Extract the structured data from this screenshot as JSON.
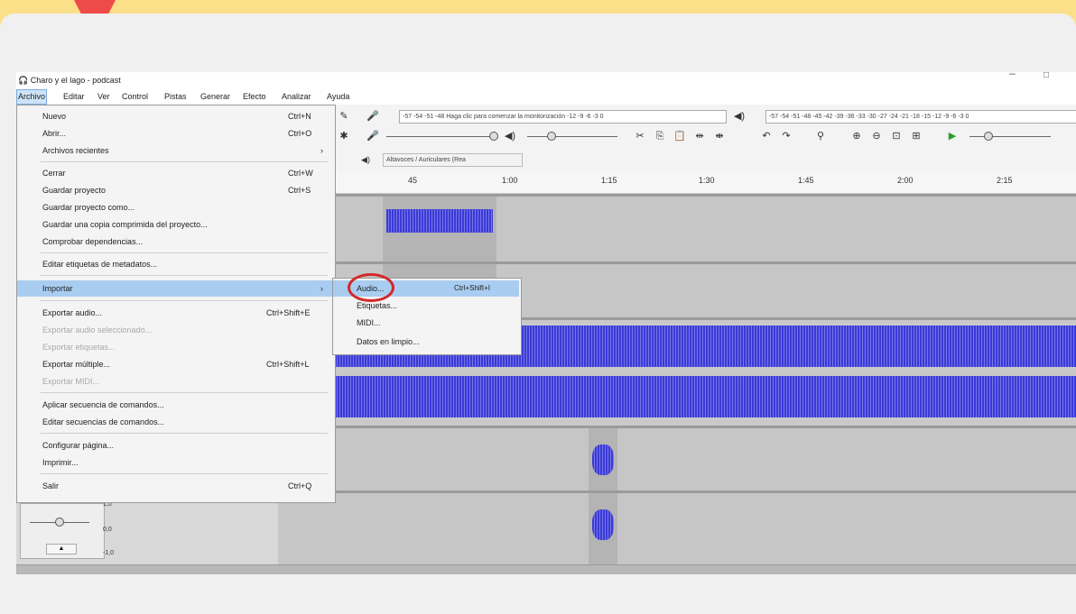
{
  "window": {
    "title": "Charo y el lago - podcast",
    "minimize": "–",
    "maximize": "□"
  },
  "menubar": [
    "Archivo",
    "Editar",
    "Ver",
    "Control",
    "Pistas",
    "Generar",
    "Efecto",
    "Analizar",
    "Ayuda"
  ],
  "file_menu": [
    {
      "label": "Nuevo",
      "shortcut": "Ctrl+N",
      "state": "normal"
    },
    {
      "label": "Abrir...",
      "shortcut": "Ctrl+O",
      "state": "normal"
    },
    {
      "label": "Archivos recientes",
      "shortcut": "",
      "arrow": "›",
      "state": "normal"
    },
    {
      "label": "Cerrar",
      "shortcut": "Ctrl+W",
      "state": "normal"
    },
    {
      "label": "Guardar proyecto",
      "shortcut": "Ctrl+S",
      "state": "normal"
    },
    {
      "label": "Guardar proyecto como...",
      "shortcut": "",
      "state": "normal"
    },
    {
      "label": "Guardar una copia comprimida del proyecto...",
      "shortcut": "",
      "state": "normal"
    },
    {
      "label": "Comprobar dependencias...",
      "shortcut": "",
      "state": "normal"
    },
    {
      "label": "Editar etiquetas de metadatos...",
      "shortcut": "",
      "state": "normal"
    },
    {
      "label": "Importar",
      "shortcut": "",
      "arrow": "›",
      "state": "highlighted"
    },
    {
      "label": "Exportar audio...",
      "shortcut": "Ctrl+Shift+E",
      "state": "normal"
    },
    {
      "label": "Exportar audio seleccionado...",
      "shortcut": "",
      "state": "disabled"
    },
    {
      "label": "Exportar etiquetas...",
      "shortcut": "",
      "state": "disabled"
    },
    {
      "label": "Exportar múltiple...",
      "shortcut": "Ctrl+Shift+L",
      "state": "normal"
    },
    {
      "label": "Exportar MIDI...",
      "shortcut": "",
      "state": "disabled"
    },
    {
      "label": "Aplicar secuencia de comandos...",
      "shortcut": "",
      "state": "normal"
    },
    {
      "label": "Editar secuencias de comandos...",
      "shortcut": "",
      "state": "normal"
    },
    {
      "label": "Configurar página...",
      "shortcut": "",
      "state": "normal"
    },
    {
      "label": "Imprimir...",
      "shortcut": "",
      "state": "normal"
    },
    {
      "label": "Salir",
      "shortcut": "Ctrl+Q",
      "state": "normal"
    }
  ],
  "import_submenu": [
    {
      "label": "Audio...",
      "shortcut": "Ctrl+Shift+I",
      "state": "highlighted"
    },
    {
      "label": "Etiquetas...",
      "shortcut": "",
      "state": "normal"
    },
    {
      "label": "MIDI...",
      "shortcut": "",
      "state": "normal"
    },
    {
      "label": "Datos en limpio...",
      "shortcut": "",
      "state": "normal"
    }
  ],
  "toolbar": {
    "record_meter_text": "-57 -54 -51 -48  Haga clic para comenzar la monitorización  -12 -9 -6 -3 0",
    "playback_meter_text": "-57 -54 -51 -48 -45 -42 -39 -36 -33 -30 -27 -24 -21 -18 -15 -12 -9 -6 -3 0",
    "output_device": "Altavoces / Auriculares (Rea"
  },
  "timeline": [
    "45",
    "1:00",
    "1:15",
    "1:30",
    "1:45",
    "2:00",
    "2:15"
  ],
  "track_scale": [
    "1,0",
    "0,0",
    "-1,0"
  ]
}
